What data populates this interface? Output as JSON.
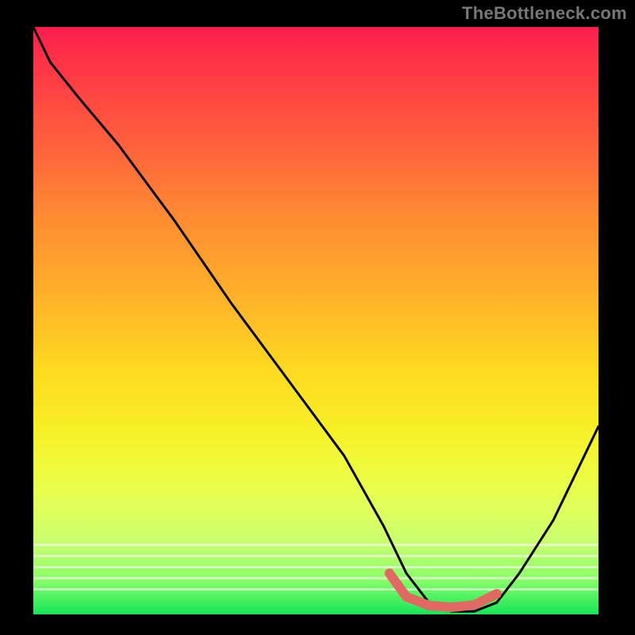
{
  "watermark": "TheBottleneck.com",
  "chart_data": {
    "type": "line",
    "title": "",
    "xlabel": "",
    "ylabel": "",
    "xlim": [
      0,
      100
    ],
    "ylim": [
      0,
      100
    ],
    "series": [
      {
        "name": "curve",
        "color": "#000000",
        "x": [
          0,
          3,
          8,
          15,
          25,
          35,
          45,
          55,
          62,
          66,
          70,
          74,
          78,
          82,
          86,
          92,
          100
        ],
        "y": [
          100,
          94,
          88,
          80,
          67,
          53,
          40,
          27,
          15,
          7,
          2,
          0.5,
          0.5,
          2,
          7,
          16,
          32
        ]
      },
      {
        "name": "highlight",
        "color": "#e06a61",
        "x": [
          63,
          66,
          70,
          74,
          78,
          82
        ],
        "y": [
          7,
          3,
          1.5,
          1.2,
          1.6,
          3.5
        ]
      }
    ],
    "gradient_stops": [
      {
        "pos": 0,
        "color": "#ff1e4e"
      },
      {
        "pos": 50,
        "color": "#ffce22"
      },
      {
        "pos": 75,
        "color": "#f4ff3e"
      },
      {
        "pos": 100,
        "color": "#16e558"
      }
    ]
  }
}
